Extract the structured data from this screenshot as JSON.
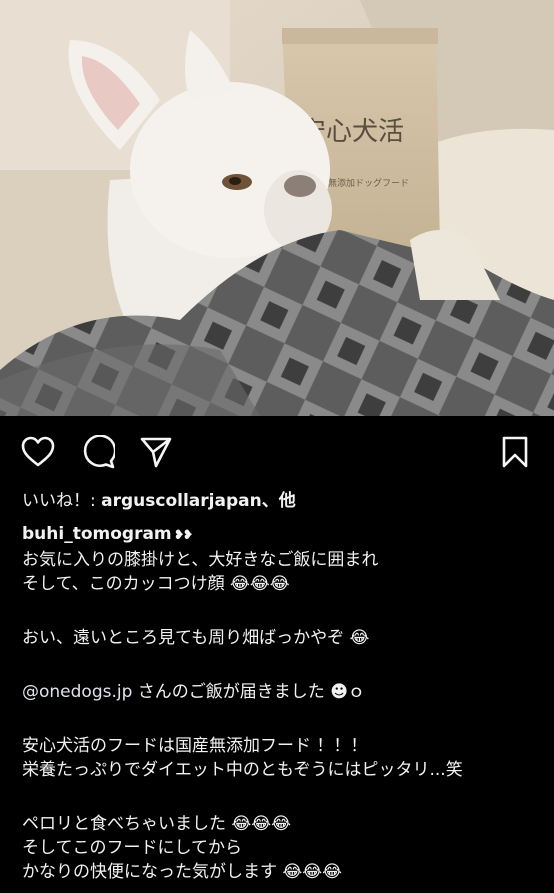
{
  "post": {
    "image_description_icon": "photo",
    "package_label": "安心犬活",
    "package_sub": "国産無添加ドッグフード"
  },
  "actions": {
    "like_icon": "heart-icon",
    "comment_icon": "comment-icon",
    "share_icon": "send-icon",
    "save_icon": "bookmark-icon"
  },
  "likes": {
    "prefix": "いいね！: ",
    "text": "arguscollarjapan、他"
  },
  "author": {
    "username": "buhi_tomogram",
    "badge": "❥❥"
  },
  "caption": {
    "line1": "お気に入りの膝掛けと、大好きなご飯に囲まれ",
    "line2": "そして、このカッコつけ顔 😂😂😂",
    "line3": "おい、遠いところ見ても周り畑ばっかやぞ 😂",
    "line4_mention": "@onedogs.jp",
    "line4_rest": " さんのご飯が届きました ☻ｏ",
    "line5": "安心犬活のフードは国産無添加フード ！！！",
    "line6": "栄養たっぷりでダイエット中のともぞうにはピッタリ...笑",
    "line7": "ペロリと食べちゃいました 😂😂😂",
    "line8": "そしてこのフードにしてから",
    "line9": "かなりの快便になった気がします 😂😂😂"
  },
  "colors": {
    "background": "#000000",
    "text": "#f2f2f2"
  }
}
